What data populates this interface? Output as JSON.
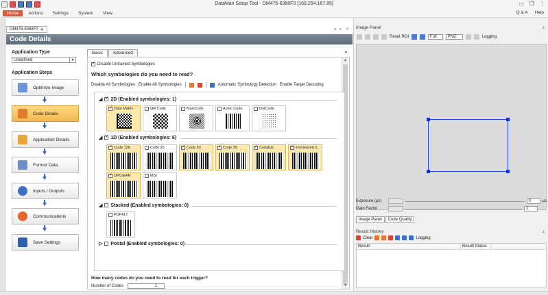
{
  "window": {
    "title": "DataMan Setup Tool - DM475-6368F0 [169.254.167.85]"
  },
  "menu": {
    "items": [
      "Home",
      "Actions",
      "Settings",
      "System",
      "View"
    ],
    "right": [
      "Q & A",
      "Help"
    ]
  },
  "document_tab": {
    "label": "DM475-6368F0"
  },
  "page_title": "Code Details",
  "steps_panel": {
    "application_type_label": "Application Type",
    "application_type_value": "Undefined",
    "application_steps_label": "Application Steps",
    "steps": [
      "Optimize Image",
      "Code Details",
      "Application Details",
      "Format Data",
      "Inputs / Outputs",
      "Communications",
      "Save Settings"
    ],
    "active_step": "Code Details"
  },
  "tabs": [
    "Basic",
    "Advanced"
  ],
  "content": {
    "disable_untrained": "Disable Untrained Symbologies",
    "question": "Which symbologies do you need to read?",
    "actions": [
      "Disable All Symbologies",
      "Enable All Symbologies",
      "Automatic Symbology Detection",
      "Enable Target Decoding"
    ],
    "group_2d": {
      "title": "2D (Enabled symbologies: 1)",
      "items": [
        {
          "label": "Data Matrix",
          "enabled": true
        },
        {
          "label": "QR Code",
          "enabled": false
        },
        {
          "label": "MaxiCode",
          "enabled": false
        },
        {
          "label": "Aztec Code",
          "enabled": false
        },
        {
          "label": "DotCode",
          "enabled": false
        }
      ]
    },
    "group_1d": {
      "title": "1D (Enabled symbologies: 6)",
      "items": [
        {
          "label": "Code 128",
          "enabled": true
        },
        {
          "label": "Code 25",
          "enabled": false
        },
        {
          "label": "Code 93",
          "enabled": true
        },
        {
          "label": "Code 39",
          "enabled": true
        },
        {
          "label": "Codabar",
          "enabled": true
        },
        {
          "label": "Interleaved 2...",
          "enabled": true
        },
        {
          "label": "UPC/EAN",
          "enabled": true
        },
        {
          "label": "MSI",
          "enabled": false
        }
      ]
    },
    "group_stacked": {
      "title": "Stacked (Enabled symbologies: 0)",
      "items": [
        {
          "label": "PDF417",
          "enabled": false
        }
      ]
    },
    "group_postal": {
      "title": "Postal (Enabled symbologies: 0)"
    },
    "how_many": "How many codes do you need to read for each trigger?",
    "number_of_codes_label": "Number of Codes",
    "number_of_codes_value": "1"
  },
  "image_panel": {
    "title": "Image Panel",
    "reset_roi": "Reset ROI",
    "zoom": "Full",
    "format": "PNG",
    "logging": "Logging",
    "exposure_label": "Exposure (µs)",
    "exposure_value": "0",
    "exposure_unit": "µs",
    "gain_label": "Gain Factor",
    "gain_value": "1",
    "tabs": [
      "Image Panel",
      "Code Quality"
    ]
  },
  "result_history": {
    "title": "Result History",
    "clear": "Clear",
    "logging": "Logging",
    "columns": [
      "Result",
      "Result Status"
    ]
  }
}
